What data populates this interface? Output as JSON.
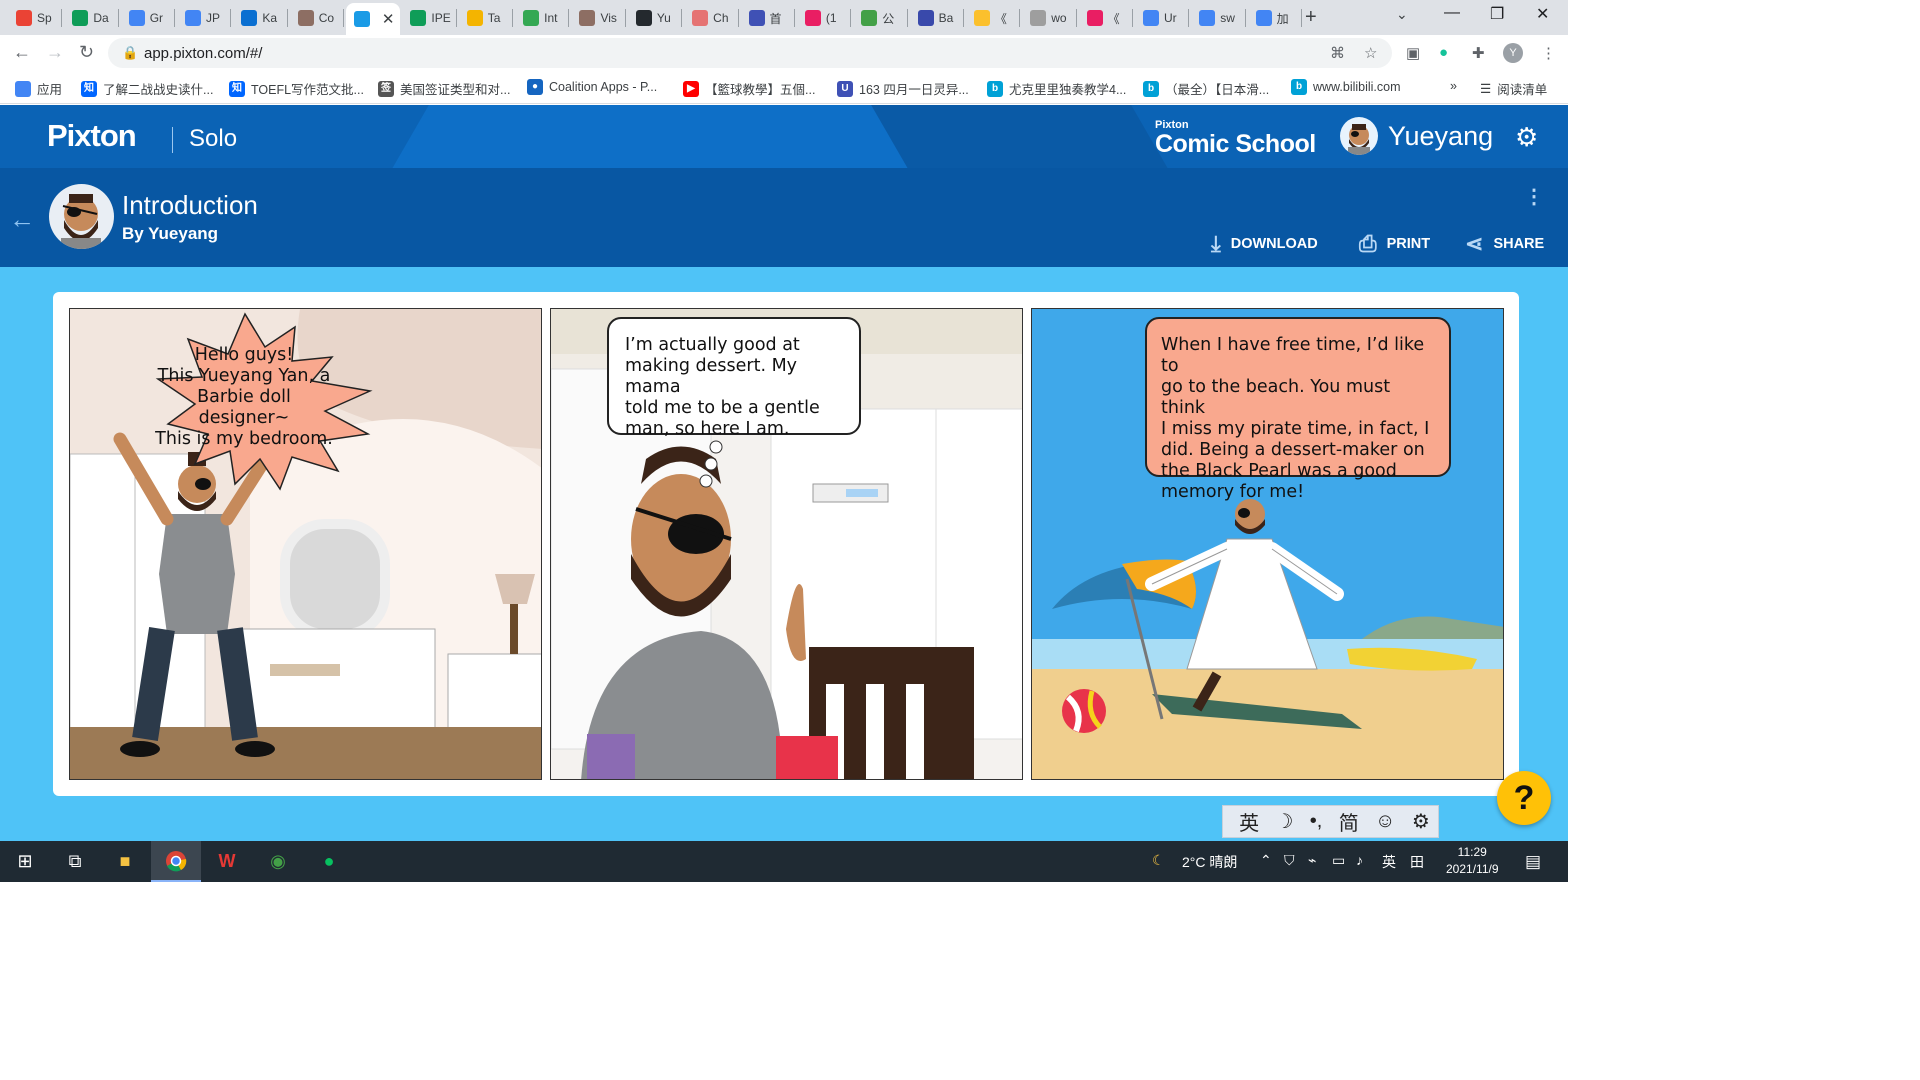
{
  "browser": {
    "tabs": [
      {
        "label": "Sp",
        "icon": "gmail-icon",
        "color": "#ea4335"
      },
      {
        "label": "Da",
        "icon": "sheets-icon",
        "color": "#0f9d58"
      },
      {
        "label": "Gr",
        "icon": "docs-icon",
        "color": "#4285f4"
      },
      {
        "label": "JP",
        "icon": "docs-icon",
        "color": "#4285f4"
      },
      {
        "label": "Ka",
        "icon": "onedrive-icon",
        "color": "#0a6fd1"
      },
      {
        "label": "Co",
        "icon": "brown-icon",
        "color": "#8d6e63"
      },
      {
        "label": "",
        "icon": "pixton-icon",
        "color": "#1a9be6",
        "active": true
      },
      {
        "label": "IPE",
        "icon": "sheets-icon",
        "color": "#0f9d58"
      },
      {
        "label": "Ta",
        "icon": "slides-icon",
        "color": "#f4b400"
      },
      {
        "label": "Int",
        "icon": "drive-icon",
        "color": "#34a853"
      },
      {
        "label": "Vis",
        "icon": "brown-icon",
        "color": "#8d6e63"
      },
      {
        "label": "Yu",
        "icon": "github-icon",
        "color": "#24292e"
      },
      {
        "label": "Ch",
        "icon": "chart-icon",
        "color": "#e57373"
      },
      {
        "label": "首",
        "icon": "circle-blue-icon",
        "color": "#3f51b5"
      },
      {
        "label": "(1",
        "icon": "colorful-icon",
        "color": "#e91e63"
      },
      {
        "label": "公",
        "icon": "green-circle-icon",
        "color": "#43a047"
      },
      {
        "label": "Ba",
        "icon": "baidu-icon",
        "color": "#3949ab"
      },
      {
        "label": "《",
        "icon": "youku-icon",
        "color": "#fbc02d"
      },
      {
        "label": "wo",
        "icon": "gray-icon",
        "color": "#9e9e9e"
      },
      {
        "label": "《",
        "icon": "pink-icon",
        "color": "#e91e63"
      },
      {
        "label": "Ur",
        "icon": "docs-icon",
        "color": "#4285f4"
      },
      {
        "label": "sw",
        "icon": "google-icon",
        "color": "#4285f4"
      },
      {
        "label": "加",
        "icon": "google-icon",
        "color": "#4285f4"
      }
    ],
    "url": "app.pixton.com/#/",
    "profile_initial": "Y",
    "bookmarks": [
      {
        "label": "应用",
        "icon": "apps-grid-icon",
        "color": "#4285f4"
      },
      {
        "label": "了解二战战史读什...",
        "icon": "zhihu-icon",
        "color": "#0066ff"
      },
      {
        "label": "TOEFL写作范文批...",
        "icon": "zhihu-icon",
        "color": "#0066ff"
      },
      {
        "label": "美国签证类型和对...",
        "icon": "visa-icon",
        "color": "#555555"
      },
      {
        "label": "Coalition Apps - P...",
        "icon": "person-icon",
        "color": "#1565c0"
      },
      {
        "label": "【籃球教學】五個...",
        "icon": "youtube-icon",
        "color": "#ff0000"
      },
      {
        "label": "163 四月一日灵异...",
        "icon": "u-icon",
        "color": "#3f51b5"
      },
      {
        "label": "尤克里里独奏教学4...",
        "icon": "bilibili-icon",
        "color": "#00a1d6"
      },
      {
        "label": "（最全）【日本滑...",
        "icon": "bilibili-icon",
        "color": "#00a1d6"
      },
      {
        "label": "www.bilibili.com",
        "icon": "bilibili-icon",
        "color": "#00a1d6"
      }
    ],
    "bookmarks_more": "»",
    "reading_list": "阅读清单"
  },
  "app": {
    "logo": "Pixton",
    "mode": "Solo",
    "school_small": "Pixton",
    "school": "Comic School",
    "user_name": "Yueyang",
    "comic_title": "Introduction",
    "comic_author": "By Yueyang",
    "actions": {
      "download": "DOWNLOAD",
      "print": "PRINT",
      "share": "SHARE"
    },
    "panels": [
      {
        "bubble": "Hello guys!\nThis Yueyang Yan, a\nBarbie doll designer~\nThis is my bedroom.",
        "bubble_color": "#f9a88e"
      },
      {
        "bubble": "I’m actually good at\nmaking dessert. My mama\ntold me to be a gentle\nman, so here I am.",
        "bubble_color": "#ffffff"
      },
      {
        "bubble": "When I have free time, I’d like to\ngo to the beach. You must think\nI miss my pirate time, in fact, I\ndid. Being a dessert-maker on\nthe Black Pearl was a good\nmemory for me!",
        "bubble_color": "#f9a88e"
      }
    ],
    "help": "?"
  },
  "ime": [
    "英",
    "☽",
    "•,",
    "简",
    "☺",
    "⚙"
  ],
  "taskbar": {
    "weather": "2°C 晴朗",
    "lang": "英",
    "time": "11:29",
    "date": "2021/11/9"
  }
}
